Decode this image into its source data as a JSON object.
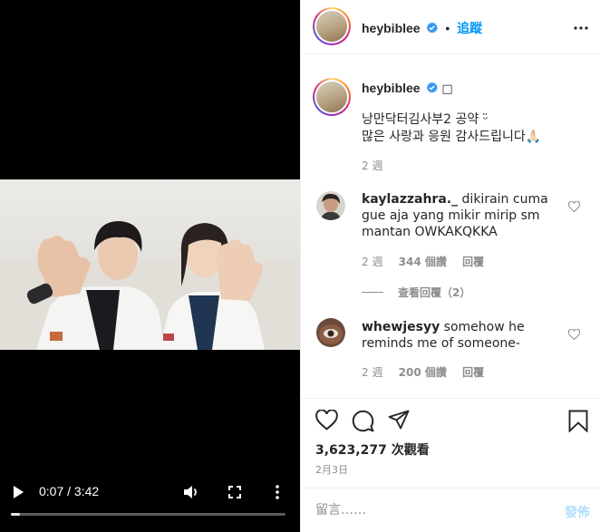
{
  "video": {
    "current_time": "0:07",
    "separator": "/",
    "duration": "3:42",
    "progress_fraction": 0.032,
    "icons": {
      "play": "play-icon",
      "volume": "volume-icon",
      "fullscreen": "fullscreen-icon",
      "more": "more-vertical-icon"
    }
  },
  "header": {
    "username": "heybiblee",
    "bullet": "•",
    "follow_label": "追蹤",
    "more_icon": "more-horizontal-icon"
  },
  "caption": {
    "username": "heybiblee",
    "trailing_glyph": "□",
    "line1": "낭만닥터김사부2 공약 ᵕ̈",
    "line2": "많은 사랑과 응원 감사드립니다🙏🏻",
    "age": "2 週"
  },
  "comments": [
    {
      "username": "kaylazzahra._",
      "text": "dikirain cuma gue aja yang mikir mirip sm mantan OWKAKQKKA",
      "age": "2 週",
      "likes": "344 個讚",
      "reply_label": "回覆"
    },
    {
      "username": "whewjesyy",
      "text": "somehow he reminds me of someone-",
      "age": "2 週",
      "likes": "200 個讚",
      "reply_label": "回覆"
    }
  ],
  "view_replies_label": "查看回覆（2）",
  "actions": {
    "like_icon": "heart-icon",
    "comment_icon": "comment-icon",
    "share_icon": "share-icon",
    "save_icon": "bookmark-icon",
    "views": "3,623,277 次觀看",
    "date": "2月3日"
  },
  "comment_box": {
    "placeholder": "留言……",
    "post_label": "發佈"
  },
  "colors": {
    "accent": "#0095f6",
    "muted": "#8e8e8e",
    "post_disabled": "#b2dffc",
    "verified": "#3897f0"
  }
}
